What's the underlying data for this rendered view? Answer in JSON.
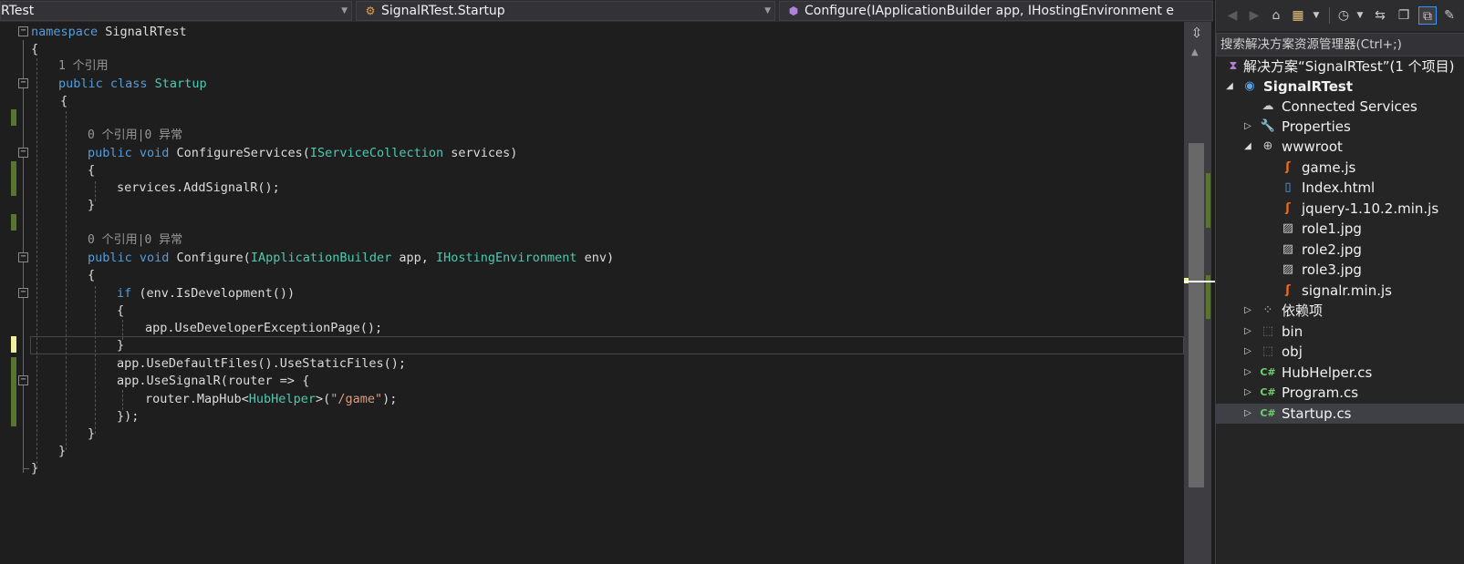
{
  "navbar": {
    "project": "RTest",
    "class": "SignalRTest.Startup",
    "member": "Configure(IApplicationBuilder app, IHostingEnvironment e"
  },
  "code": {
    "l1_kw": "namespace",
    "l1_name": " SignalRTest",
    "l2": "{",
    "lens1": "1 个引用",
    "l3_kw": "public class",
    "l3_name": " Startup",
    "l4": "{",
    "lens2": "0 个引用|0 异常",
    "l5_kw": "public void",
    "l5_rest": " ConfigureServices(",
    "l5_type": "IServiceCollection",
    "l5_end": " services)",
    "l6": "{",
    "l7": "services.AddSignalR();",
    "l8": "}",
    "lens3": "0 个引用|0 异常",
    "l9_kw": "public void",
    "l9_rest": " Configure(",
    "l9_type1": "IApplicationBuilder",
    "l9_mid": " app, ",
    "l9_type2": "IHostingEnvironment",
    "l9_end": " env)",
    "l10": "{",
    "l11_kw": "if",
    "l11_rest": " (env.IsDevelopment())",
    "l12": "{",
    "l13": "app.UseDeveloperExceptionPage();",
    "l14": "}",
    "l15": "app.UseDefaultFiles().UseStaticFiles();",
    "l16": "app.UseSignalR(router => {",
    "l17_a": "router.MapHub<",
    "l17_type": "HubHelper",
    "l17_b": ">(",
    "l17_str": "\"/game\"",
    "l17_c": ");",
    "l18": "});",
    "l19": "}",
    "l20": "}",
    "l21": "}"
  },
  "solution_explorer": {
    "search_placeholder": "搜索解决方案资源管理器(Ctrl+;)",
    "items": [
      {
        "label": "解决方案“SignalRTest”(1 个项目)",
        "icon": "solution-icon"
      },
      {
        "label": "SignalRTest",
        "icon": "web-project-icon"
      },
      {
        "label": "Connected Services",
        "icon": "cloud-icon"
      },
      {
        "label": "Properties",
        "icon": "wrench-icon"
      },
      {
        "label": "wwwroot",
        "icon": "globe-icon"
      },
      {
        "label": "game.js",
        "icon": "js-file-icon"
      },
      {
        "label": "Index.html",
        "icon": "html-file-icon"
      },
      {
        "label": "jquery-1.10.2.min.js",
        "icon": "js-file-icon"
      },
      {
        "label": "role1.jpg",
        "icon": "image-file-icon"
      },
      {
        "label": "role2.jpg",
        "icon": "image-file-icon"
      },
      {
        "label": "role3.jpg",
        "icon": "image-file-icon"
      },
      {
        "label": "signalr.min.js",
        "icon": "js-file-icon"
      },
      {
        "label": "依赖项",
        "icon": "dependencies-icon"
      },
      {
        "label": "bin",
        "icon": "folder-icon"
      },
      {
        "label": "obj",
        "icon": "folder-icon"
      },
      {
        "label": "HubHelper.cs",
        "icon": "csharp-file-icon"
      },
      {
        "label": "Program.cs",
        "icon": "csharp-file-icon"
      },
      {
        "label": "Startup.cs",
        "icon": "csharp-file-icon"
      }
    ]
  },
  "colors": {
    "keyword": "#569cd6",
    "type": "#4ec9b0",
    "string": "#d69d85",
    "saved_change": "#577430",
    "unsaved_change": "#efefa0"
  }
}
